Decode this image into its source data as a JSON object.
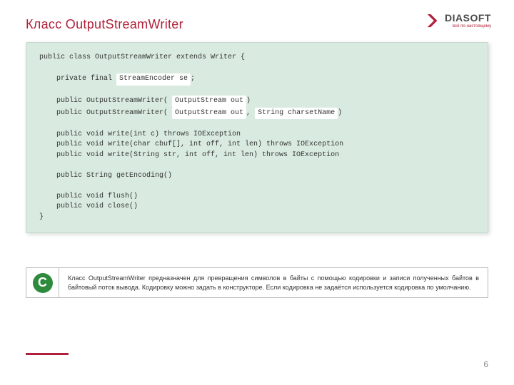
{
  "header": {
    "title": "Класс OutputStreamWriter",
    "logo_name": "DIASOFT",
    "logo_tag": "всё по-настоящему"
  },
  "code": {
    "line1": "public class OutputStreamWriter extends Writer {",
    "line2": "    private final ",
    "line2_hl": "StreamEncoder se",
    "line2_end": ";",
    "line3": "    public OutputStreamWriter( ",
    "line3_hl": "OutputStream out",
    "line3_end": ")",
    "line4": "    public OutputStreamWriter( ",
    "line4_hl1": "OutputStream out",
    "line4_mid": ", ",
    "line4_hl2": "String charsetName",
    "line4_end": ")",
    "line5": "    public void write(int c) throws IOException",
    "line6": "    public void write(char cbuf[], int off, int len) throws IOException",
    "line7": "    public void write(String str, int off, int len) throws IOException",
    "line8": "    public String getEncoding()",
    "line9": "    public void flush()",
    "line10": "    public void close()",
    "line11": "}"
  },
  "note": {
    "badge": "C",
    "text": "Класс OutputStreamWriter предназначен для превращения символов в байты с помощью кодировки и записи полученных байтов в байтовый поток вывода. Кодировку можно задать в конструкторе. Если кодировка не задаётся используется кодировка по умолчанию."
  },
  "footer": {
    "page": "6"
  }
}
